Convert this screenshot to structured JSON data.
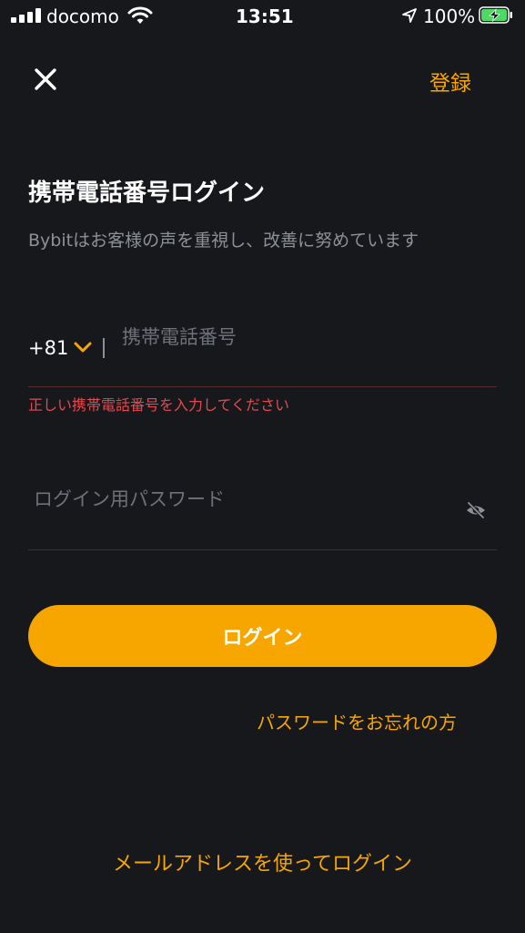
{
  "status_bar": {
    "carrier": "docomo",
    "time": "13:51",
    "battery_percent": "100%"
  },
  "header": {
    "register_label": "登録"
  },
  "main": {
    "title": "携帯電話番号ログイン",
    "subtitle": "Bybitはお客様の声を重視し、改善に努めています",
    "phone": {
      "country_code": "+81",
      "placeholder": "携帯電話番号",
      "value": "",
      "error": "正しい携帯電話番号を入力してください"
    },
    "password": {
      "placeholder": "ログイン用パスワード",
      "value": ""
    },
    "login_button": "ログイン",
    "forgot_password": "パスワードをお忘れの方",
    "email_login": "メールアドレスを使ってログイン"
  },
  "colors": {
    "background": "#17181c",
    "accent": "#f7a600",
    "error": "#e34a50",
    "muted": "#8d9097"
  },
  "icons": [
    "signal-icon",
    "wifi-icon",
    "location-icon",
    "battery-charging-icon",
    "close-icon",
    "chevron-down-icon",
    "eye-off-icon"
  ]
}
